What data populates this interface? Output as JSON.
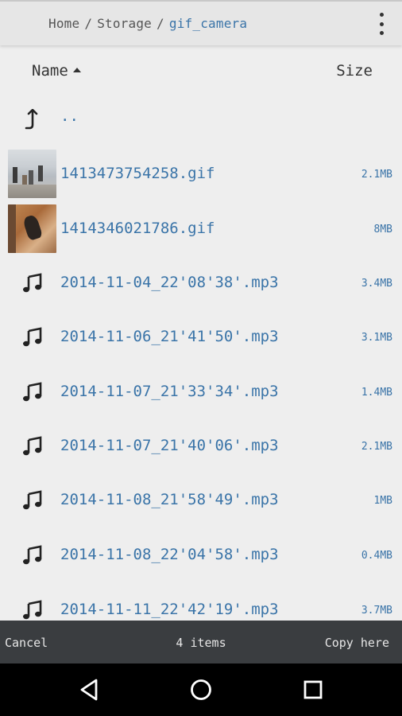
{
  "breadcrumb": {
    "items": [
      "Home",
      "Storage"
    ],
    "separator": "/",
    "current": "gif_camera"
  },
  "header": {
    "name_label": "Name",
    "size_label": "Size",
    "sort": "ascending"
  },
  "parent_row": {
    "label": "..",
    "icon": "up-arrow-icon"
  },
  "files": [
    {
      "name": "1413473754258.gif",
      "size": "2.1MB",
      "icon": "thumbnail"
    },
    {
      "name": "1414346021786.gif",
      "size": "8MB",
      "icon": "thumbnail"
    },
    {
      "name": "2014-11-04_22'08'38'.mp3",
      "size": "3.4MB",
      "icon": "music-note-icon"
    },
    {
      "name": "2014-11-06_21'41'50'.mp3",
      "size": "3.1MB",
      "icon": "music-note-icon"
    },
    {
      "name": "2014-11-07_21'33'34'.mp3",
      "size": "1.4MB",
      "icon": "music-note-icon"
    },
    {
      "name": "2014-11-07_21'40'06'.mp3",
      "size": "2.1MB",
      "icon": "music-note-icon"
    },
    {
      "name": "2014-11-08_21'58'49'.mp3",
      "size": "1MB",
      "icon": "music-note-icon"
    },
    {
      "name": "2014-11-08_22'04'58'.mp3",
      "size": "0.4MB",
      "icon": "music-note-icon"
    },
    {
      "name": "2014-11-11_22'42'19'.mp3",
      "size": "3.7MB",
      "icon": "music-note-icon"
    }
  ],
  "bottom_bar": {
    "cancel_label": "Cancel",
    "count_label": "4 items",
    "copy_label": "Copy here"
  },
  "colors": {
    "accent": "#3a74a8",
    "background": "#eeeeee",
    "bottom_bar": "#3a3d40",
    "nav_bar": "#000000"
  }
}
